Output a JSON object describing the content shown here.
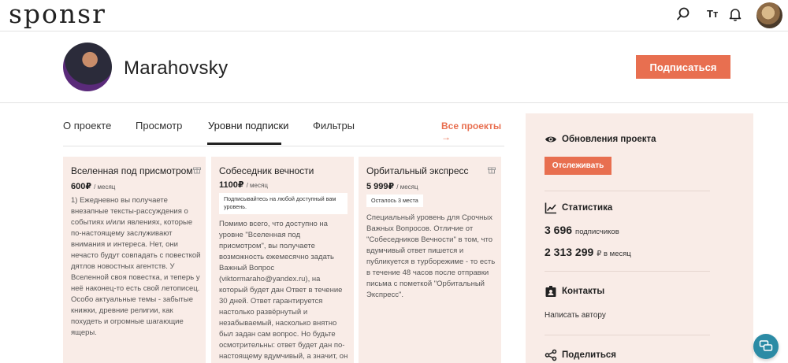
{
  "app": {
    "logo": "sponsr",
    "font_size_label": "Тт"
  },
  "header": {
    "author_name": "Marahovsky",
    "subscribe_label": "Подписаться"
  },
  "tabs": [
    {
      "label": "О проекте"
    },
    {
      "label": "Просмотр"
    },
    {
      "label": "Уровни подписки",
      "active": true
    },
    {
      "label": "Фильтры"
    }
  ],
  "all_projects_label": "Все проекты →",
  "tiers": [
    {
      "title": "Вселенная под присмотром",
      "price": "600₽",
      "period": "/ месяц",
      "text": "1) Ежедневно вы получаете внезапные тексты-рассуждения о событиях и/или явлениях, которые по-настоящему заслуживают внимания и интереса. Нет, они нечасто будут совпадать с повесткой дятлов новостных агентств. У Вселенной своя повестка, и теперь у неё наконец-то есть свой летописец. Особо актуальные темы - забытые книжки, древние религии, как похудеть и огромные шагающие ящеры."
    },
    {
      "title": "Собеседник вечности",
      "price": "1100₽",
      "period": "/ месяц",
      "note": "Подписывайтесь на любой доступный вам уровень.",
      "text": "Помимо всего, что доступно на уровне \"Вселенная под присмотром\", вы получаете возможность ежемесячно задать Важный Вопрос (viktormaraho@yandex.ru), на который будет дан Ответ в течение 30 дней. Ответ гарантируется настолько развёрнутый и незабываемый, насколько внятно был задан сам вопрос. Но будьте осмотрительны: ответ будет дан по-настоящему вдумчивый, а значит, он может"
    },
    {
      "title": "Орбитальный экспресс",
      "price": "5 999₽",
      "period": "/ месяц",
      "note": "Осталось 3 места",
      "text": "Специальный уровень для Срочных Важных Вопросов. Отличие от \"Собеседников Вечности\" в том, что вдумчивый ответ пишется и публикуется в турборежиме - то есть в течение 48 часов после отправки письма с пометкой \"Орбитальный Экспресс\"."
    }
  ],
  "sidebar": {
    "updates_title": "Обновления проекта",
    "follow_label": "Отслеживать",
    "stats_title": "Статистика",
    "subscribers_value": "3 696",
    "subscribers_label": "подписчиков",
    "income_value": "2 313 299",
    "income_label": "₽ в месяц",
    "contacts_title": "Контакты",
    "write_author_label": "Написать автору",
    "share_title": "Поделиться"
  },
  "colors": {
    "accent": "#e86f50",
    "card_bg": "#f9ece7",
    "chat": "#2b8ba5"
  },
  "icons": [
    "search-icon",
    "bell-icon",
    "gift-icon",
    "eye-icon",
    "chart-icon",
    "contact-icon",
    "share-icon",
    "chat-icon"
  ]
}
